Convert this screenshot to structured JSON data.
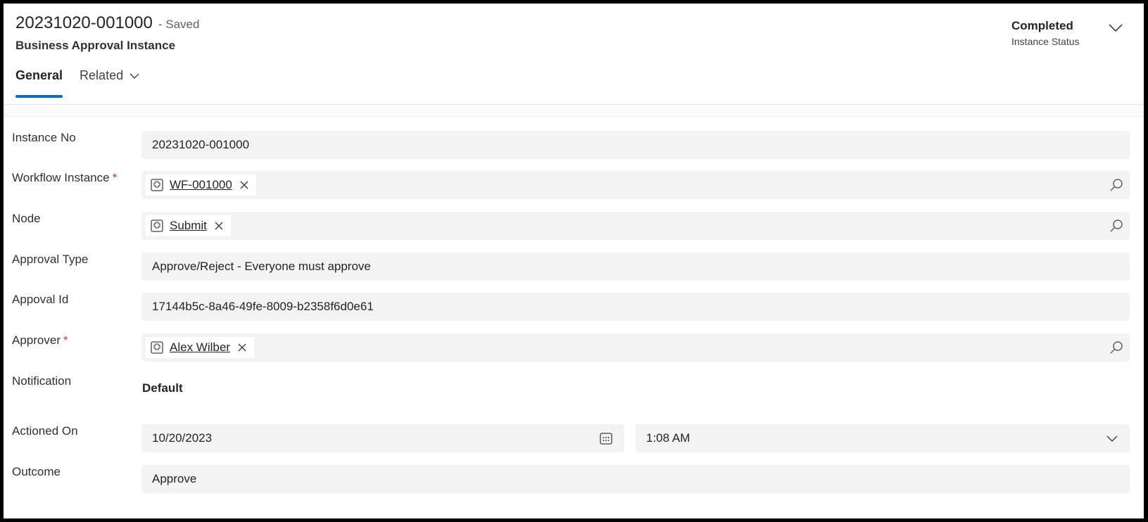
{
  "header": {
    "record_title": "20231020-001000",
    "saved_status": "- Saved",
    "entity_name": "Business Approval Instance",
    "status_value": "Completed",
    "status_label": "Instance Status"
  },
  "tabs": [
    {
      "label": "General",
      "active": true
    },
    {
      "label": "Related",
      "active": false,
      "has_dropdown": true
    }
  ],
  "fields": {
    "instance_no": {
      "label": "Instance No",
      "value": "20231020-001000"
    },
    "workflow_instance": {
      "label": "Workflow Instance",
      "required_marker": "*",
      "value": "WF-001000"
    },
    "node": {
      "label": "Node",
      "value": "Submit"
    },
    "approval_type": {
      "label": "Approval Type",
      "value": "Approve/Reject - Everyone must approve"
    },
    "approval_id": {
      "label": "Appoval Id",
      "value": "17144b5c-8a46-49fe-8009-b2358f6d0e61"
    },
    "approver": {
      "label": "Approver",
      "required_marker": "*",
      "value": "Alex Wilber"
    },
    "notification": {
      "label": "Notification",
      "value": "Default"
    },
    "actioned_on": {
      "label": "Actioned On",
      "date": "10/20/2023",
      "time": "1:08 AM"
    },
    "outcome": {
      "label": "Outcome",
      "value": "Approve"
    }
  },
  "icons": {
    "lookup_entity": "entity-record-icon",
    "remove": "close-icon",
    "search": "search-icon",
    "calendar": "calendar-icon",
    "dropdown": "chevron-down-icon"
  },
  "colors": {
    "accent": "#0f6cbd",
    "required": "#c4314b",
    "field_bg": "#f3f3f3"
  }
}
